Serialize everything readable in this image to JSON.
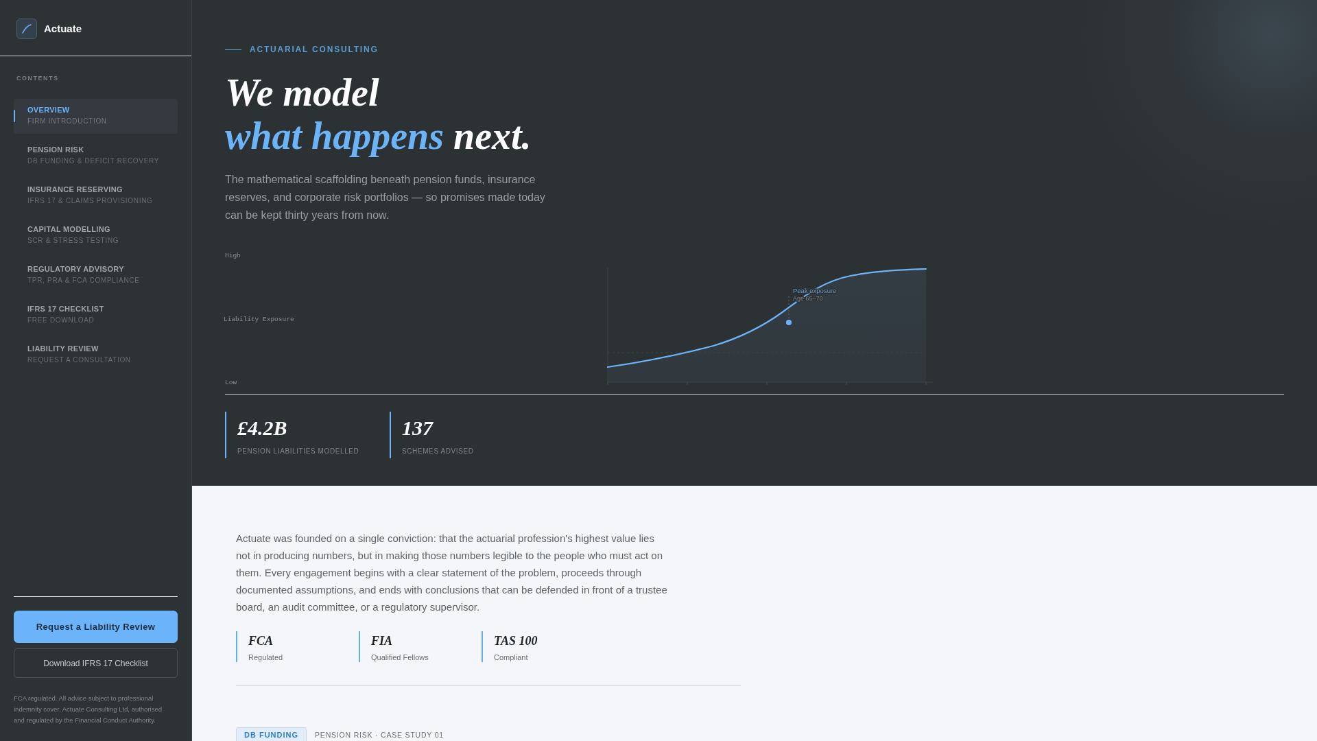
{
  "sidebar": {
    "brand": "Actuate",
    "contents_label": "CONTENTS",
    "items": [
      {
        "title": "OVERVIEW",
        "subtitle": "FIRM INTRODUCTION",
        "selected": true
      },
      {
        "title": "PENSION RISK",
        "subtitle": "DB FUNDING & DEFICIT RECOVERY",
        "selected": false
      },
      {
        "title": "INSURANCE RESERVING",
        "subtitle": "IFRS 17 & CLAIMS PROVISIONING",
        "selected": false
      },
      {
        "title": "CAPITAL MODELLING",
        "subtitle": "SCR & STRESS TESTING",
        "selected": false
      },
      {
        "title": "REGULATORY ADVISORY",
        "subtitle": "TPR, PRA & FCA COMPLIANCE",
        "selected": false
      },
      {
        "title": "IFRS 17 CHECKLIST",
        "subtitle": "FREE DOWNLOAD",
        "selected": false
      },
      {
        "title": "LIABILITY REVIEW",
        "subtitle": "REQUEST A CONSULTATION",
        "selected": false
      }
    ],
    "buttons": [
      {
        "label": "Request a Liability Review",
        "kind": "primary"
      },
      {
        "label": "Download IFRS 17 Checklist",
        "kind": "secondary"
      }
    ],
    "footnote": "FCA regulated. All advice subject to professional indemnity cover. Actuate Consulting Ltd, authorised and regulated by the Financial Conduct Authority."
  },
  "hero": {
    "eyebrow": "ACTUARIAL CONSULTING",
    "headline": [
      [
        {
          "text": "We model",
          "accent": false
        }
      ],
      [
        {
          "text": "what happens",
          "accent": true
        },
        {
          "text": "next.",
          "accent": false
        }
      ]
    ],
    "lede": "The mathematical scaffolding beneath pension funds, insurance reserves, and corporate risk portfolios — so promises made today can be kept thirty years from now.",
    "chart": {
      "y_high": "High",
      "y_title": "Liability Exposure",
      "y_low": "Low",
      "annotation": {
        "title": "Peak exposure",
        "subtitle": "Age 65–70"
      }
    },
    "stats": [
      {
        "value": "£4.2B",
        "label": "PENSION LIABILITIES MODELLED"
      },
      {
        "value": "137",
        "label": "SCHEMES ADVISED"
      }
    ]
  },
  "about": {
    "text": "Actuate was founded on a single conviction: that the actuarial profession's highest value lies not in producing numbers, but in making those numbers legible to the people who must act on them. Every engagement begins with a clear statement of the problem, proceeds through documented assumptions, and ends with conclusions that can be defended in front of a trustee board, an audit committee, or a regulatory supervisor.",
    "credentials": [
      {
        "title": "FCA",
        "subtitle": "Regulated"
      },
      {
        "title": "FIA",
        "subtitle": "Qualified Fellows"
      },
      {
        "title": "TAS 100",
        "subtitle": "Compliant"
      }
    ]
  },
  "case_study": {
    "tag": "DB FUNDING",
    "meta": "PENSION RISK · CASE STUDY 01"
  }
}
